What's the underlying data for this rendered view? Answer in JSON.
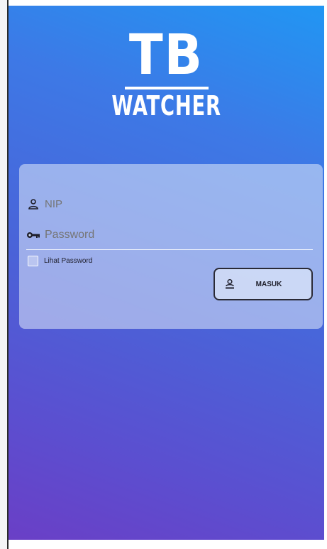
{
  "app": {
    "logo_top": "TB",
    "logo_bottom": "WATCHER"
  },
  "login": {
    "nip_placeholder": "NIP",
    "password_placeholder": "Password",
    "show_password_label": "Lihat Password",
    "show_password_checked": false,
    "submit_label": "MASUK"
  },
  "icons": {
    "nip": "person-icon",
    "password": "key-icon",
    "submit": "person-stamp-icon"
  },
  "colors": {
    "gradient_top": "#2196f3",
    "gradient_bottom": "#6a3fc6",
    "card": "#e1ebfa",
    "text": "#1e1e2a"
  }
}
